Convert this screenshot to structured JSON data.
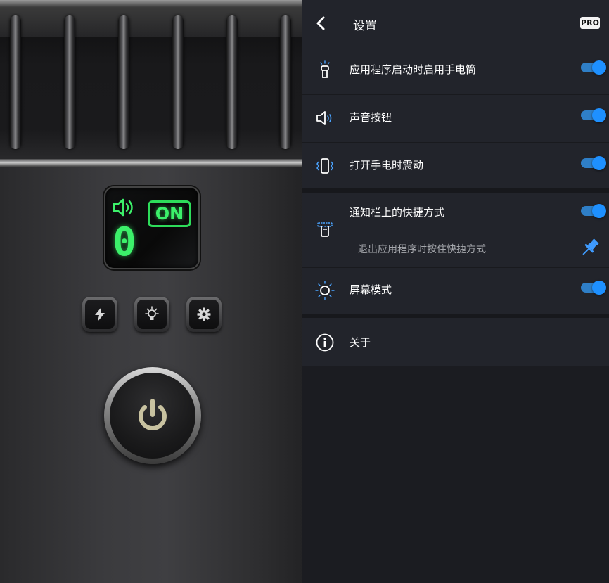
{
  "flashlight": {
    "display": {
      "status": "ON",
      "counter": "0",
      "sound_icon": "speaker-icon"
    },
    "buttons": [
      {
        "name": "flash-button",
        "icon": "lightning-icon"
      },
      {
        "name": "light-mode-button",
        "icon": "lightbulb-icon"
      },
      {
        "name": "settings-button",
        "icon": "gear-icon"
      }
    ],
    "power_icon": "power-icon",
    "colors": {
      "led_green": "#3cf06a",
      "power_icon": "#c8c2a0"
    }
  },
  "settings": {
    "title": "设置",
    "pro_badge": "PRO",
    "back_icon": "chevron-left-icon",
    "items": [
      {
        "label": "应用程序启动时启用手电筒",
        "icon": "flashlight-icon",
        "toggle": true
      },
      {
        "label": "声音按钮",
        "icon": "speaker-icon",
        "toggle": true
      },
      {
        "label": "打开手电时震动",
        "icon": "vibrate-icon",
        "toggle": true
      },
      {
        "label": "通知栏上的快捷方式",
        "icon": "notification-shortcut-icon",
        "toggle": true,
        "sub_label": "退出应用程序时按住快捷方式",
        "sub_icon": "pin-icon"
      },
      {
        "label": "屏幕模式",
        "icon": "sun-icon",
        "toggle": true
      },
      {
        "label": "关于",
        "icon": "info-icon"
      }
    ],
    "colors": {
      "toggle_on": "#1e90ff",
      "background": "#1b1c21",
      "row": "#22242b"
    }
  }
}
